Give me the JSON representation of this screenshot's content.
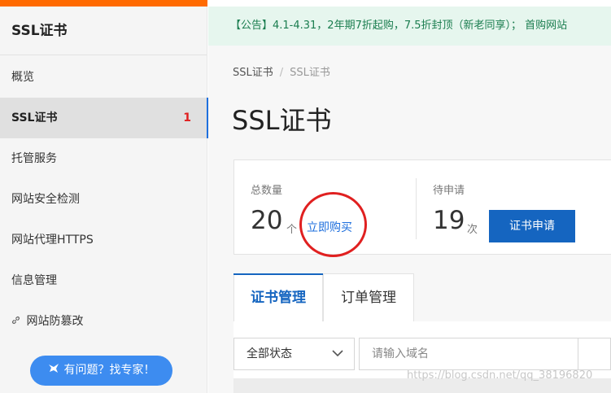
{
  "sidebar": {
    "title": "SSL证书",
    "items": [
      {
        "label": "概览"
      },
      {
        "label": "SSL证书",
        "badge": "1"
      },
      {
        "label": "托管服务"
      },
      {
        "label": "网站安全检测"
      },
      {
        "label": "网站代理HTTPS"
      },
      {
        "label": "信息管理"
      },
      {
        "label": "网站防篡改"
      }
    ],
    "help_button": "有问题？找专家！"
  },
  "notice": "【公告】4.1-4.31，2年期7折起购，7.5折封顶（新老同享）； 首购网站",
  "breadcrumb": [
    "SSL证书",
    "SSL证书"
  ],
  "page_title": "SSL证书",
  "stats": {
    "total_label": "总数量",
    "total_value": "20",
    "total_unit": "个",
    "buy_link": "立即购买",
    "pending_label": "待申请",
    "pending_value": "19",
    "pending_unit": "次",
    "apply_button": "证书申请"
  },
  "tabs": [
    {
      "label": "证书管理",
      "active": true
    },
    {
      "label": "订单管理",
      "active": false
    }
  ],
  "filter": {
    "status_value": "全部状态",
    "search_placeholder": "请输入域名"
  },
  "watermark": "https://blog.csdn.net/qq_38196820",
  "colors": {
    "accent": "#1565c0",
    "notice_bg": "#e6f6ee",
    "notice_text": "#1a7d4f",
    "annotation_circle": "#e02020",
    "badge": "#e02020"
  }
}
